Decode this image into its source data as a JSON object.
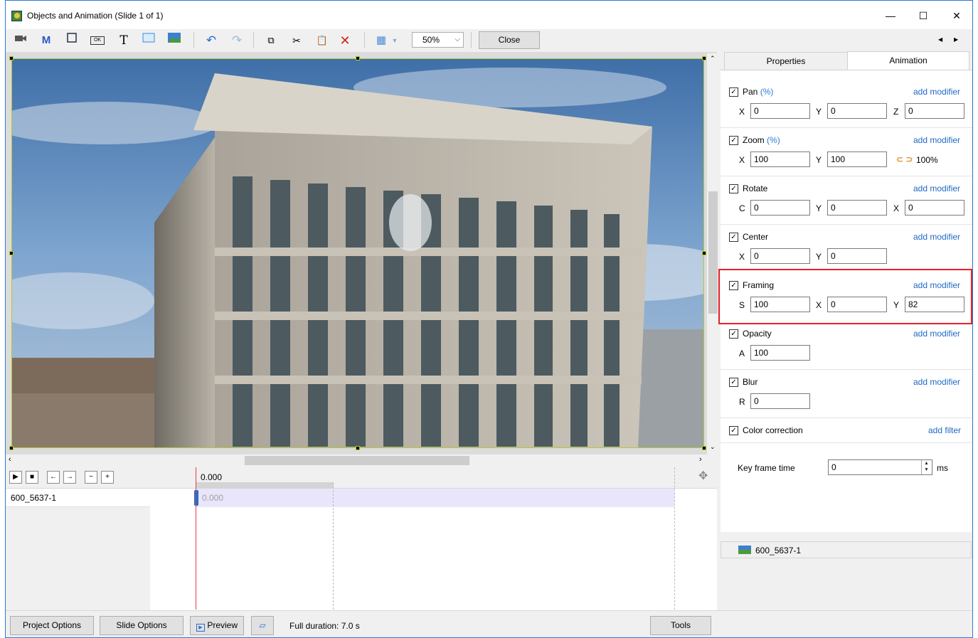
{
  "window": {
    "title": "Objects and Animation (Slide 1 of 1)",
    "minimize": "—",
    "maximize": "☐",
    "close": "✕"
  },
  "toolbar": {
    "zoom_value": "50%",
    "close_label": "Close",
    "m_label": "M",
    "t_label": "T",
    "ok_label": "OK",
    "nav_left": "◀",
    "nav_right": "▶"
  },
  "timeline": {
    "time_header": "0.000",
    "row_time": "0.000",
    "object_name": "600_5637-1"
  },
  "tabs": {
    "properties": "Properties",
    "animation": "Animation"
  },
  "animation": {
    "add_modifier": "add modifier",
    "add_filter": "add filter",
    "pan": {
      "label": "Pan",
      "unit": "(%)",
      "x_label": "X",
      "x": "0",
      "y_label": "Y",
      "y": "0",
      "z_label": "Z",
      "z": "0"
    },
    "zoom": {
      "label": "Zoom",
      "unit": "(%)",
      "x_label": "X",
      "x": "100",
      "y_label": "Y",
      "y": "100",
      "ratio": "100%"
    },
    "rotate": {
      "label": "Rotate",
      "c_label": "C",
      "c": "0",
      "y_label": "Y",
      "y": "0",
      "x_label": "X",
      "x": "0"
    },
    "center": {
      "label": "Center",
      "x_label": "X",
      "x": "0",
      "y_label": "Y",
      "y": "0"
    },
    "framing": {
      "label": "Framing",
      "s_label": "S",
      "s": "100",
      "x_label": "X",
      "x": "0",
      "y_label": "Y",
      "y": "82"
    },
    "opacity": {
      "label": "Opacity",
      "a_label": "A",
      "a": "100"
    },
    "blur": {
      "label": "Blur",
      "r_label": "R",
      "r": "0"
    },
    "color_correction": {
      "label": "Color correction"
    },
    "keyframe": {
      "label": "Key frame time",
      "value": "0",
      "unit": "ms"
    }
  },
  "object_list": {
    "item": "600_5637-1"
  },
  "bottom": {
    "project_options": "Project Options",
    "slide_options": "Slide Options",
    "preview": "Preview",
    "full_duration": "Full duration: 7.0 s",
    "tools": "Tools"
  },
  "colors": {
    "accent_blue": "#1f69c4",
    "highlight_red": "#e5202a",
    "timeline_bar": "#e9e6fb",
    "selection_frame": "#b3c832"
  }
}
